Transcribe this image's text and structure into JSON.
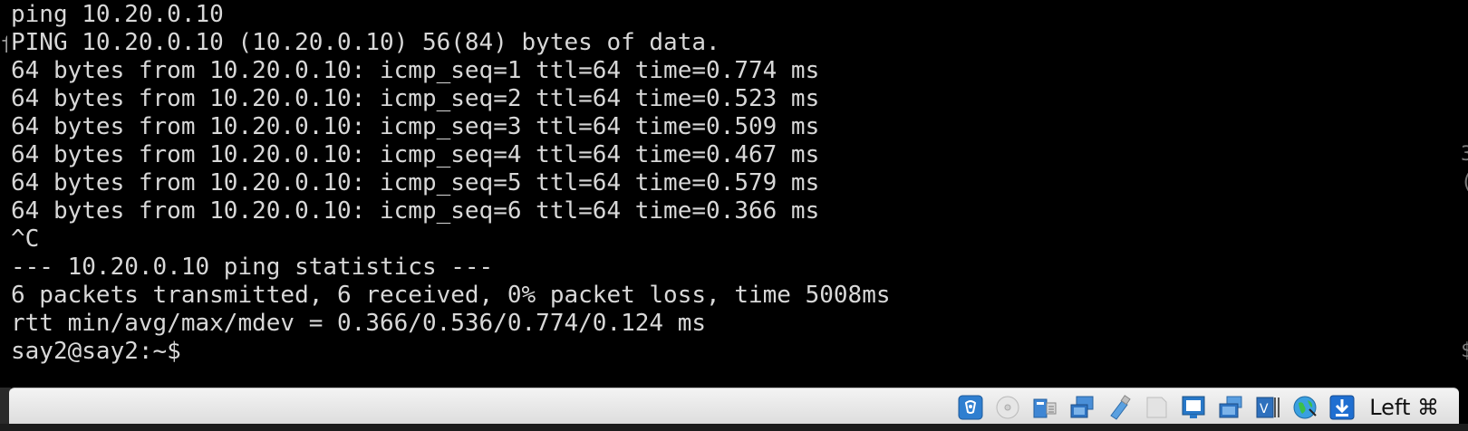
{
  "terminal": {
    "lines": [
      "ping 10.20.0.10",
      "PING 10.20.0.10 (10.20.0.10) 56(84) bytes of data.",
      "64 bytes from 10.20.0.10: icmp_seq=1 ttl=64 time=0.774 ms",
      "64 bytes from 10.20.0.10: icmp_seq=2 ttl=64 time=0.523 ms",
      "64 bytes from 10.20.0.10: icmp_seq=3 ttl=64 time=0.509 ms",
      "64 bytes from 10.20.0.10: icmp_seq=4 ttl=64 time=0.467 ms",
      "64 bytes from 10.20.0.10: icmp_seq=5 ttl=64 time=0.579 ms",
      "64 bytes from 10.20.0.10: icmp_seq=6 ttl=64 time=0.366 ms",
      "^C",
      "--- 10.20.0.10 ping statistics ---",
      "6 packets transmitted, 6 received, 0% packet loss, time 5008ms",
      "rtt min/avg/max/mdev = 0.366/0.536/0.774/0.124 ms",
      "say2@say2:~$"
    ],
    "left_edge_fragment": "f",
    "right_edge_fragments": [
      "3",
      "(",
      "$"
    ],
    "text_color": "#d8d8d8",
    "background": "#000000"
  },
  "statusbar": {
    "icons": [
      "audio-icon",
      "optical-drive-icon",
      "shared-folders-icon",
      "network-icon",
      "usb-icon",
      "floppy-icon",
      "display-icon",
      "snapshot-icon",
      "video-capture-icon",
      "mouse-integration-icon",
      "download-icon"
    ],
    "host_key_label": "Left ⌘"
  }
}
